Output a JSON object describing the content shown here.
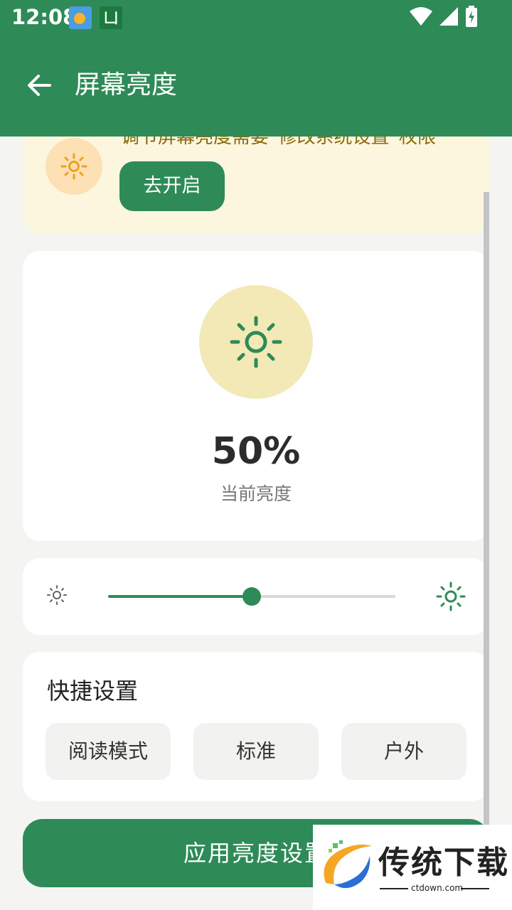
{
  "status": {
    "time": "12:08",
    "app2_label": "凵"
  },
  "appbar": {
    "title": "屏幕亮度"
  },
  "permission": {
    "message": "调节屏幕亮度需要“修改系统设置”权限",
    "button": "去开启"
  },
  "brightness": {
    "value": 50,
    "display": "50%",
    "label": "当前亮度"
  },
  "quick": {
    "title": "快捷设置",
    "options": [
      "阅读模式",
      "标准",
      "户外"
    ]
  },
  "apply": {
    "label": "应用亮度设置"
  },
  "watermark": {
    "text": "传统下载",
    "sub": "ctdown.com"
  },
  "colors": {
    "primary": "#2e8b57",
    "permission_bg": "#fdf6df",
    "sun_bg": "#f2e9b6"
  }
}
